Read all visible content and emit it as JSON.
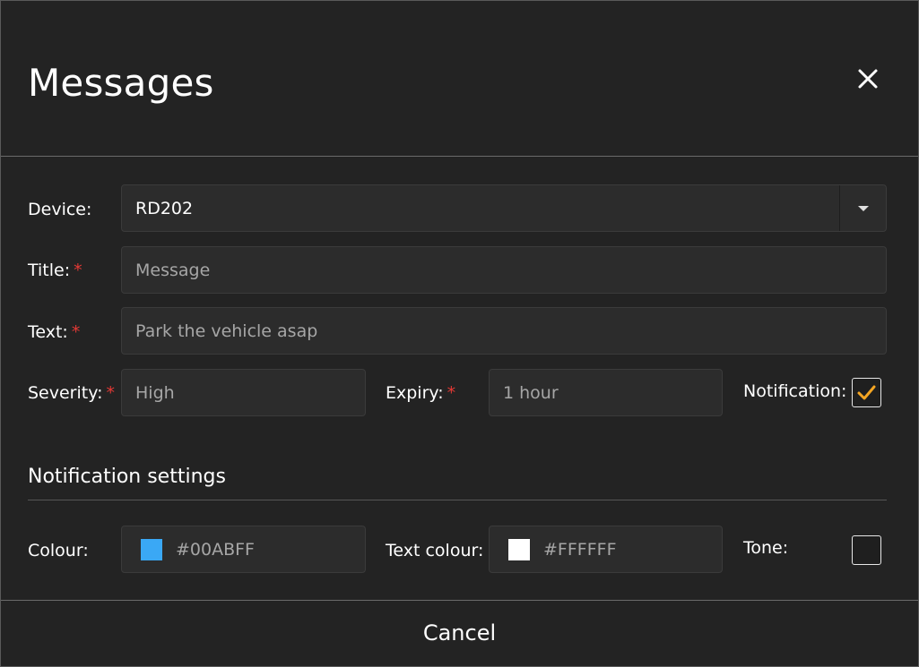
{
  "dialog": {
    "title": "Messages"
  },
  "form": {
    "device": {
      "label": "Device:",
      "value": "RD202"
    },
    "title": {
      "label": "Title:",
      "required_mark": "*",
      "value": "Message"
    },
    "text": {
      "label": "Text:",
      "required_mark": "*",
      "value": "Park the vehicle asap"
    },
    "severity": {
      "label": "Severity:",
      "required_mark": "*",
      "value": "High"
    },
    "expiry": {
      "label": "Expiry:",
      "required_mark": "*",
      "value": "1 hour"
    },
    "notification": {
      "label": "Notification:",
      "checked": true
    }
  },
  "notification_settings": {
    "heading": "Notification settings",
    "colour": {
      "label": "Colour:",
      "value": "#00ABFF",
      "swatch": "#3aa8f5"
    },
    "text_colour": {
      "label": "Text colour:",
      "value": "#FFFFFF",
      "swatch": "#ffffff"
    },
    "tone": {
      "label": "Tone:",
      "checked": false
    }
  },
  "footer": {
    "cancel_label": "Cancel"
  },
  "colors": {
    "background": "#232323",
    "field": "#2c2c2c",
    "required": "#e53935",
    "check": "#f5a623"
  },
  "icons": {
    "close": "close-icon",
    "dropdown": "chevron-down-icon",
    "check": "check-icon"
  }
}
